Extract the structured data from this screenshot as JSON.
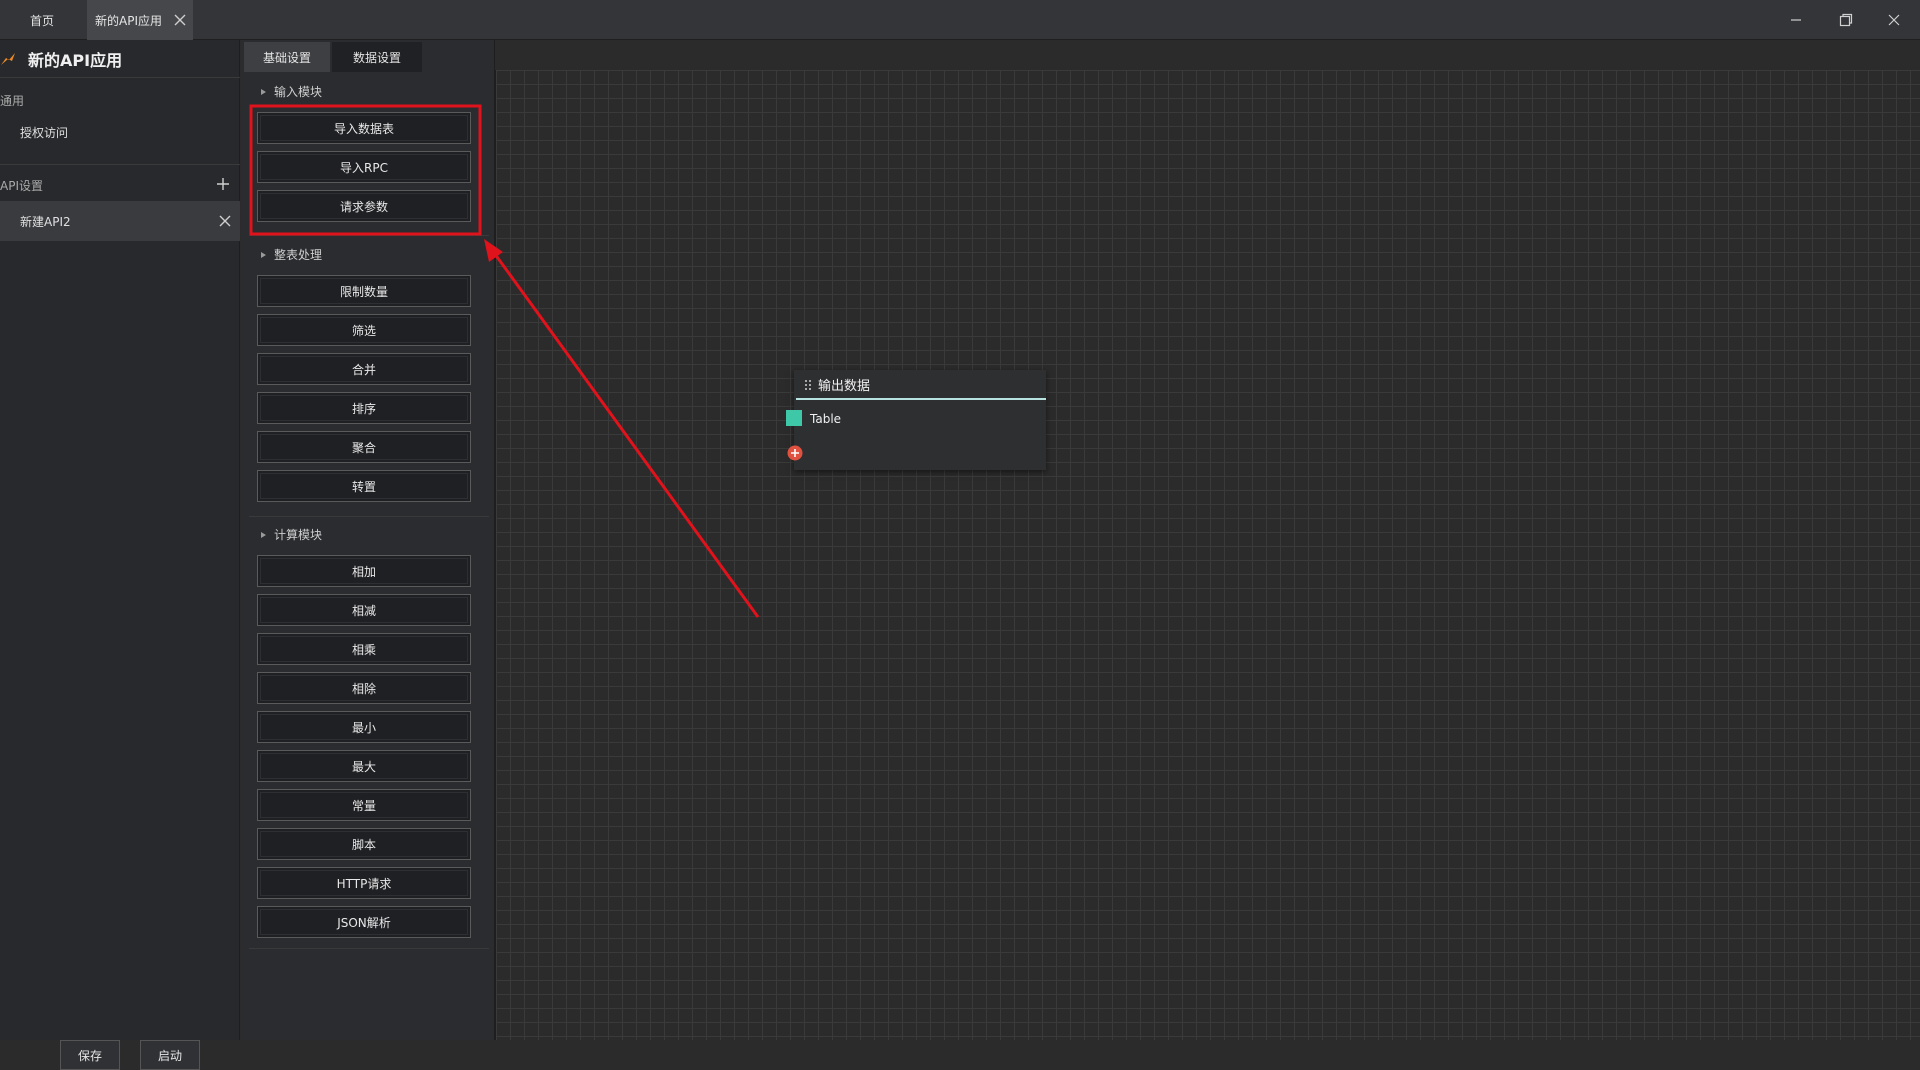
{
  "titlebar": {
    "tab_home": "首页",
    "tab_app": "新的API应用"
  },
  "left_panel": {
    "app_title": "新的API应用",
    "section_general": "通用",
    "item_auth": "授权访问",
    "section_api": "API设置",
    "item_api": "新建API2",
    "save_label": "保存",
    "start_label": "启动"
  },
  "module_panel": {
    "tab_basic": "基础设置",
    "tab_data": "数据设置",
    "groups": [
      {
        "title": "输入模块",
        "items": [
          "导入数据表",
          "导入RPC",
          "请求参数"
        ]
      },
      {
        "title": "整表处理",
        "items": [
          "限制数量",
          "筛选",
          "合并",
          "排序",
          "聚合",
          "转置"
        ]
      },
      {
        "title": "计算模块",
        "items": [
          "相加",
          "相减",
          "相乘",
          "相除",
          "最小",
          "最大",
          "常量",
          "脚本",
          "HTTP请求",
          "JSON解析"
        ]
      }
    ]
  },
  "node": {
    "title": "输出数据",
    "port_label": "Table"
  },
  "colors": {
    "annotation_red": "#e0121b",
    "port_green": "#3fc8a7",
    "add_port_red": "#e0523f",
    "accent_orange": "#f08a24"
  }
}
